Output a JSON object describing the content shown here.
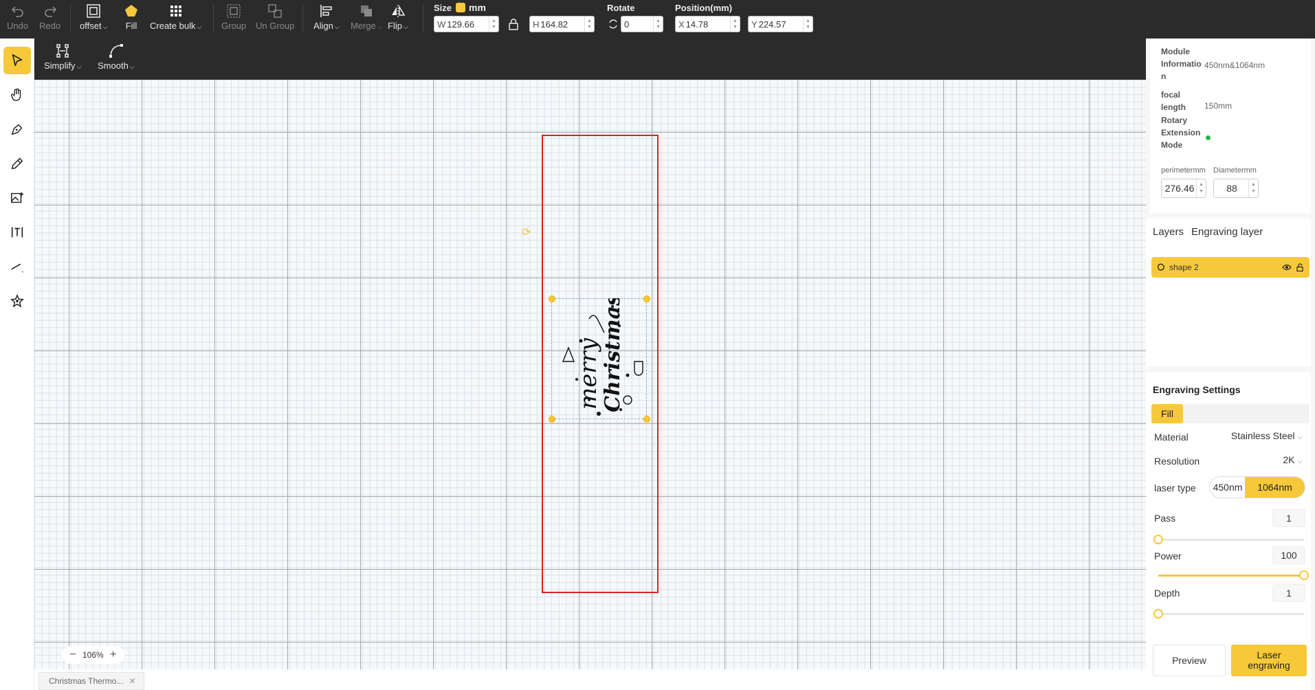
{
  "toolbar": {
    "undo": "Undo",
    "redo": "Redo",
    "offset": "offset",
    "fill": "Fill",
    "create_bulk": "Create bulk",
    "group": "Group",
    "ungroup": "Un Group",
    "align": "Align",
    "merge": "Merge",
    "flip": "Flip",
    "size_label": "Size",
    "unit": "mm",
    "width_prefix": "W",
    "width": "129.66",
    "height_prefix": "H",
    "height": "164.82",
    "rotate_label": "Rotate",
    "rotate": "0",
    "position_label": "Position(mm)",
    "x_prefix": "X",
    "x": "14.78",
    "y_prefix": "Y",
    "y": "224.57"
  },
  "subbar": {
    "simplify": "Simplify",
    "smooth": "Smooth"
  },
  "left_tools": [
    "select-tool",
    "hand-tool",
    "pen-tool",
    "pencil-tool",
    "image-tool",
    "text-tool",
    "line-tool",
    "magic-tool"
  ],
  "canvas": {
    "zoom": "106%",
    "artwork_line1": "merry",
    "artwork_line2": "Christmas",
    "workarea_color": "#e02020"
  },
  "document_tab": {
    "title": "Christmas Thermo..."
  },
  "module": {
    "module_info_key": "Module Informatio n",
    "module_info_val": "450nm&1064nm",
    "focal_key": "focal length",
    "focal_val": "150mm",
    "rotary_key": "Rotary Extension Mode",
    "perimeter_label": "perimetermm",
    "perimeter": "276.46",
    "diameter_label": "Diametermm",
    "diameter": "88"
  },
  "layers": {
    "tab_layers": "Layers",
    "tab_engraving": "Engraving layer",
    "item": "shape 2"
  },
  "engraving": {
    "title": "Engraving Settings",
    "mode": "Fill",
    "material_label": "Material",
    "material": "Stainless Steel",
    "resolution_label": "Resolution",
    "resolution": "2K",
    "laser_type_label": "laser type",
    "laser_a": "450nm",
    "laser_b": "1064nm",
    "pass_label": "Pass",
    "pass": "1",
    "pass_level": 0,
    "power_label": "Power",
    "power": "100",
    "power_level": 1,
    "depth_label": "Depth",
    "depth": "1",
    "depth_level": 0,
    "preview": "Preview",
    "laser_engraving": "Laser engraving"
  },
  "colors": {
    "accent": "#f7c93a",
    "toolbar_bg": "#2b2b2b",
    "status_green": "#22bb44"
  }
}
